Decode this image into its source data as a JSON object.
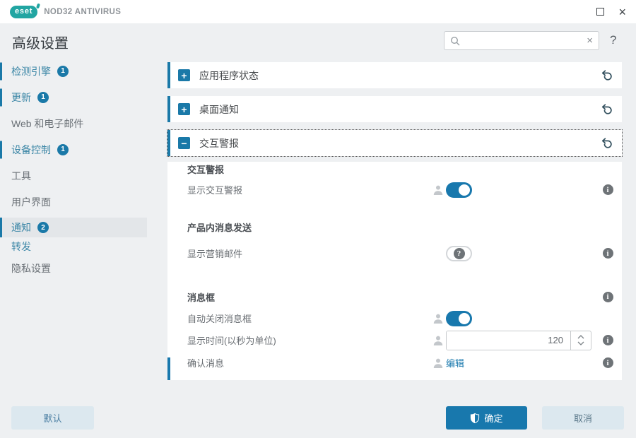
{
  "titlebar": {
    "logo_text": "eset",
    "product_name": "NOD32 ANTIVIRUS",
    "close_glyph": "×"
  },
  "header": {
    "title": "高级设置",
    "search_value": "",
    "clear_glyph": "×",
    "help_glyph": "?"
  },
  "sidebar": {
    "items": [
      {
        "label": "检测引擎",
        "badge": "1"
      },
      {
        "label": "更新",
        "badge": "1"
      },
      {
        "label": "Web 和电子邮件"
      },
      {
        "label": "设备控制",
        "badge": "1"
      },
      {
        "label": "工具"
      },
      {
        "label": "用户界面"
      },
      {
        "label": "通知",
        "badge": "2"
      },
      {
        "label": "转发"
      },
      {
        "label": "隐私设置"
      }
    ]
  },
  "sections": [
    {
      "title": "应用程序状态",
      "toggle_glyph": "+",
      "expanded": false
    },
    {
      "title": "桌面通知",
      "toggle_glyph": "+",
      "expanded": false
    },
    {
      "title": "交互警报",
      "toggle_glyph": "−",
      "expanded": true
    }
  ],
  "panel": {
    "groups": [
      {
        "heading": "交互警报",
        "rows": [
          {
            "label": "显示交互警报",
            "control": "toggle-on",
            "info": true
          }
        ]
      },
      {
        "heading": "产品内消息发送",
        "rows": [
          {
            "label": "显示营销邮件",
            "control": "toggle-unknown",
            "unknown_glyph": "?",
            "info": true
          }
        ]
      },
      {
        "heading": "消息框",
        "heading_info": true,
        "rows": [
          {
            "label": "自动关闭消息框",
            "control": "toggle-on",
            "info": false
          },
          {
            "label": "显示时间(以秒为单位)",
            "control": "number",
            "value": "120",
            "info": true
          },
          {
            "label": "确认消息",
            "control": "link",
            "link_label": "编辑",
            "info": true,
            "modified": true
          }
        ]
      }
    ]
  },
  "footer": {
    "default_label": "默认",
    "ok_label": "确定",
    "cancel_label": "取消"
  },
  "icons": {
    "info_glyph": "i"
  },
  "colors": {
    "accent_blue": "#1878ad",
    "brand_teal": "#21a5a2",
    "page_bg": "#eef0f2",
    "selected_bg": "#e3e6e9",
    "info_gray": "#6e7377",
    "light_button_bg": "#dce8ef"
  }
}
